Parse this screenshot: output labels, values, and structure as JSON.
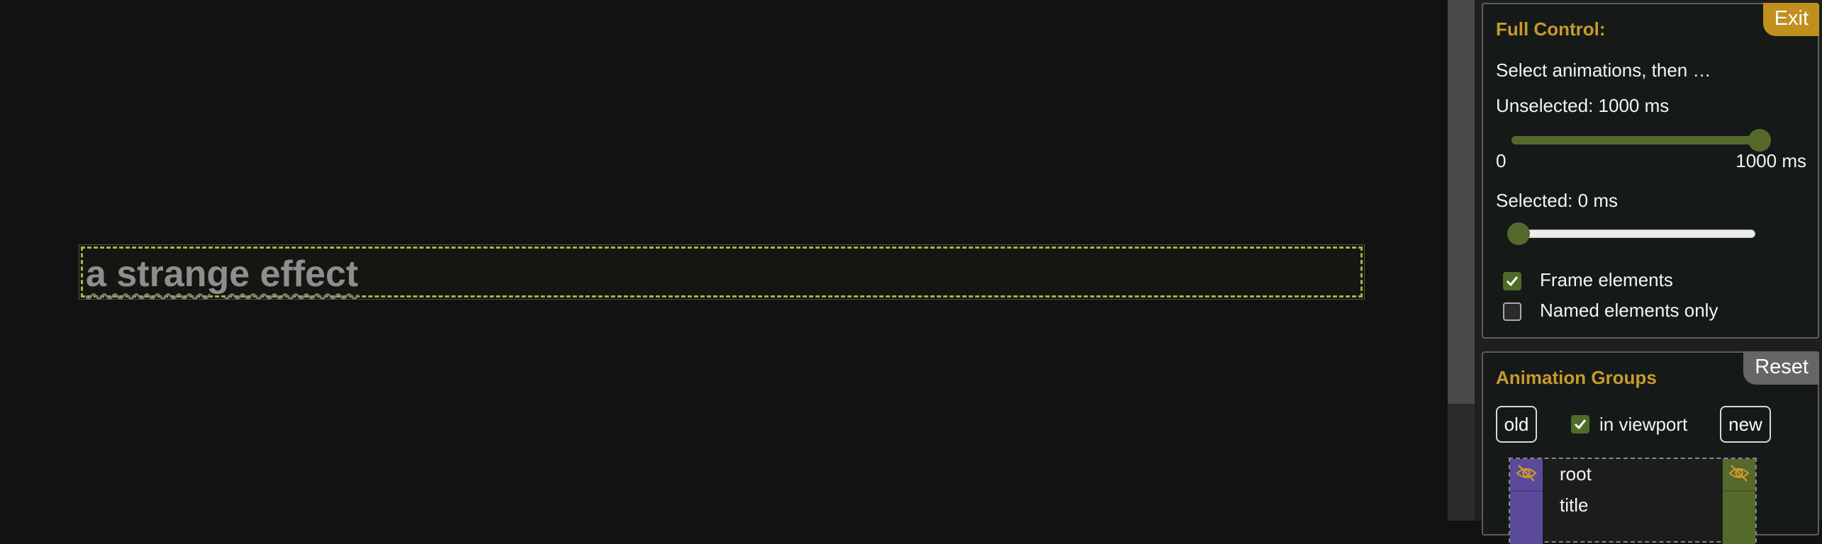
{
  "stage": {
    "headline": "a strange effect"
  },
  "panel": {
    "control": {
      "title": "Full Control:",
      "exit_label": "Exit",
      "instruction": "Select animations, then …",
      "unselected_label": "Unselected: 1000 ms",
      "unselected_value_ms": 1000,
      "slider_min_label": "0",
      "slider_max_label": "1000 ms",
      "selected_label": "Selected: 0 ms",
      "selected_value_ms": 0,
      "frame_elements": {
        "label": "Frame elements",
        "checked": true
      },
      "named_only": {
        "label": "Named elements only",
        "checked": false
      }
    },
    "groups": {
      "title": "Animation Groups",
      "reset_label": "Reset",
      "old_label": "old",
      "new_label": "new",
      "in_viewport": {
        "label": "in viewport",
        "checked": true
      },
      "items": [
        {
          "label": "root"
        },
        {
          "label": "title"
        }
      ]
    }
  },
  "colors": {
    "accent": "#c99a2a",
    "frame_border": "#9fb64f",
    "slider_green": "#55692d",
    "old_column": "#5b4a9c",
    "new_column": "#55692d"
  }
}
